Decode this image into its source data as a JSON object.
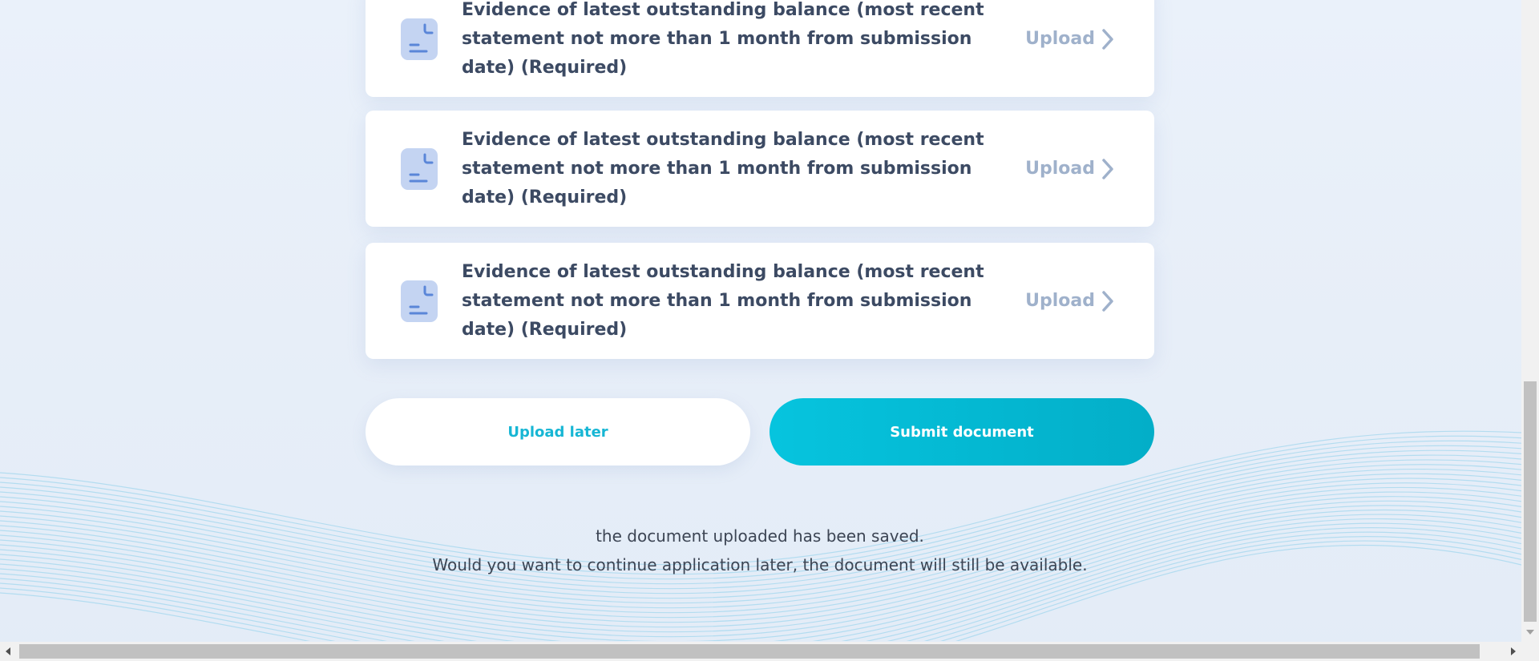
{
  "documents": [
    {
      "title": "Evidence of latest outstanding balance (most recent statement not more than 1 month from submission date) (Required)",
      "action": "Upload",
      "icon": "document-icon"
    },
    {
      "title": "Evidence of latest outstanding balance (most recent statement not more than 1 month from submission date) (Required)",
      "action": "Upload",
      "icon": "document-icon"
    },
    {
      "title": "Evidence of latest outstanding balance (most recent statement not more than 1 month from submission date) (Required)",
      "action": "Upload",
      "icon": "document-icon"
    }
  ],
  "actions": {
    "upload_later": "Upload later",
    "submit": "Submit document"
  },
  "note": {
    "line1": "the document uploaded has been saved.",
    "line2": "Would you want to continue application later, the document will still be available."
  },
  "colors": {
    "accent": "#06c4de",
    "title_text": "#3c4a63",
    "upload_link": "#9fb1cb",
    "icon_bg": "#c4d4f2",
    "icon_stroke": "#5a86d8"
  }
}
